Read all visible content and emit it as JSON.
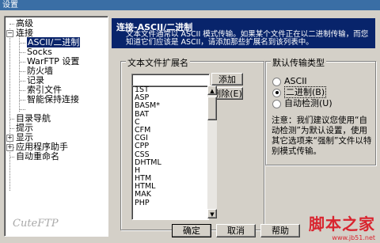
{
  "window": {
    "title": "设置"
  },
  "tree": {
    "items": [
      {
        "label": "高级"
      },
      {
        "label": "连接"
      },
      {
        "label": "ASCII/二进制"
      },
      {
        "label": "Socks"
      },
      {
        "label": "WarFTP 设置"
      },
      {
        "label": "防火墙"
      },
      {
        "label": "记录"
      },
      {
        "label": "索引文件"
      },
      {
        "label": "智能保持连接"
      },
      {
        "label": "目录导航"
      },
      {
        "label": "提示"
      },
      {
        "label": "显示"
      },
      {
        "label": "应用程序助手"
      },
      {
        "label": "自动重命名"
      }
    ],
    "logo": "CuteFTP"
  },
  "header": {
    "title": "连接-ASCII/二进制",
    "description": "文本文件通常以 ASCII 模式传输。如果某个文件正在以二进制传输，而您知道它们应该是 ASCII，请添加那些扩展名到该列表中。"
  },
  "extensions_group": {
    "title": "文本文件扩展名",
    "input_value": "",
    "add_label": "添加(D)",
    "remove_label": "删除(E)",
    "items": [
      "1ST",
      "ASP",
      "BASM*",
      "BAT",
      "C",
      "CFM",
      "CGI",
      "CPP",
      "CSS",
      "DHTML",
      "H",
      "HTM",
      "HTML",
      "MAK",
      "PHP"
    ]
  },
  "transfer_group": {
    "title": "默认传输类型",
    "options": [
      {
        "label": "ASCII",
        "selected": false
      },
      {
        "label": "二进制(B)",
        "selected": true
      },
      {
        "label": "自动检测(U)",
        "selected": false
      }
    ],
    "note": "注意：我们建议您使用“自动检测”为默认设置，使用其它选项来“强制”文件以特别模式传输。"
  },
  "buttons": {
    "ok": "确定",
    "cancel": "取消",
    "help": "帮助"
  },
  "watermark": {
    "main": "脚本之家",
    "sub": "www.jb51.net"
  }
}
